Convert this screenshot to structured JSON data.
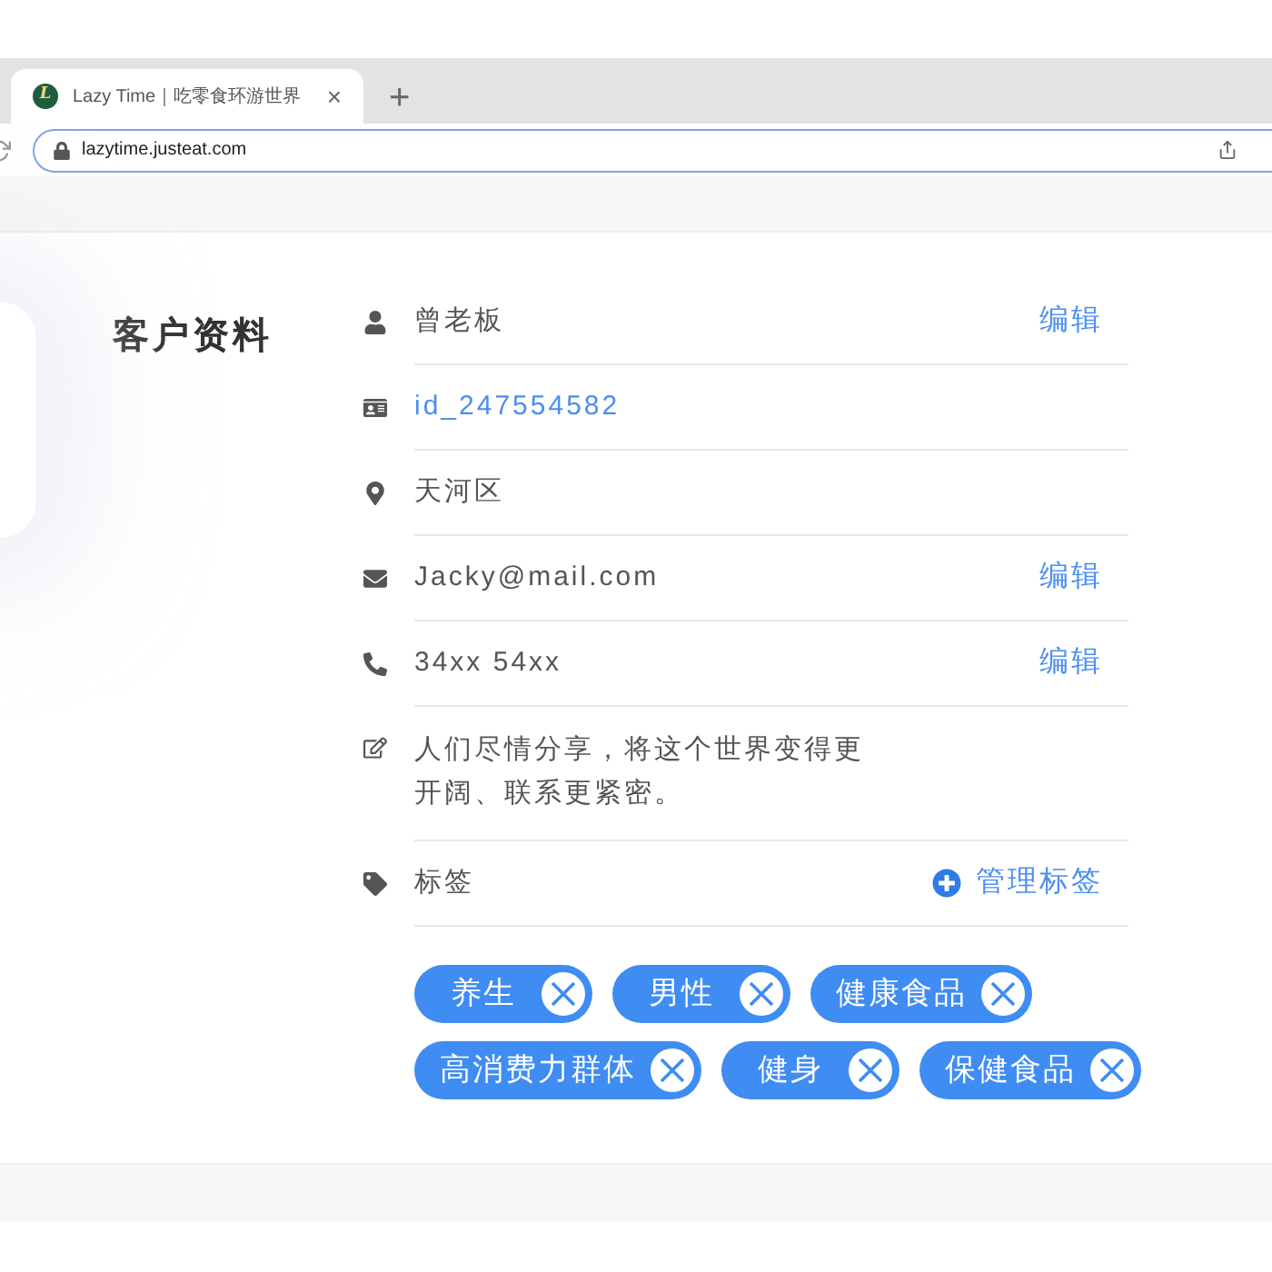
{
  "browser": {
    "tab": {
      "logo": "L",
      "title": "Lazy Time｜吃零食环游世界",
      "close": "×",
      "selected": true
    },
    "new_tab": "+",
    "url": "lazytime.justeat.com"
  },
  "profile": {
    "title": "客户资料",
    "rows": [
      {
        "kind": "name",
        "text": "曾老板",
        "link": false,
        "action": "编辑"
      },
      {
        "kind": "id",
        "text": "id_247554582",
        "link": true
      },
      {
        "kind": "address",
        "text": "天河区",
        "link": false
      },
      {
        "kind": "email",
        "text": "Jacky@mail.com",
        "link": false,
        "action": "编辑"
      },
      {
        "kind": "phone",
        "text": "34xx 54xx",
        "link": false,
        "action": "编辑"
      },
      {
        "kind": "bio",
        "text": "人们尽情分享，将这个世界变得更开阔、联系更紧密。",
        "link": false
      },
      {
        "kind": "tags",
        "text": "标签",
        "link": false,
        "action": "管理标签"
      }
    ],
    "tags": [
      "养生",
      "男性",
      "健康食品",
      "高消费力群体",
      "健身",
      "保健食品"
    ]
  }
}
